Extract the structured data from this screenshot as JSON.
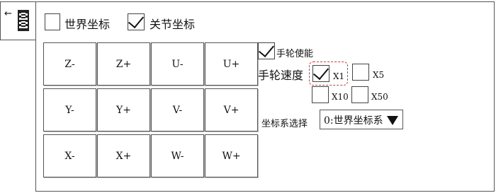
{
  "side_tab": {
    "arrow": "←",
    "icon": "panel-icon"
  },
  "coord_mode": {
    "world_label": "世界坐标",
    "world_checked": false,
    "joint_label": "关节坐标",
    "joint_checked": true
  },
  "jog_buttons": [
    [
      "Z-",
      "Z+",
      "U-",
      "U+"
    ],
    [
      "Y-",
      "Y+",
      "V-",
      "V+"
    ],
    [
      "X-",
      "X+",
      "W-",
      "W+"
    ]
  ],
  "handwheel": {
    "enable_label": "手轮使能",
    "enable_checked": true,
    "speed_label": "手轮速度",
    "x1_label": "X1",
    "x1_checked": true,
    "x5_label": "X5",
    "x5_checked": false,
    "x10_label": "X10",
    "x10_checked": false,
    "x50_label": "X50",
    "x50_checked": false
  },
  "coord_system": {
    "label": "坐标系选择",
    "selected": "0:世界坐标系",
    "dropdown_icon": "triangle-down-icon"
  }
}
